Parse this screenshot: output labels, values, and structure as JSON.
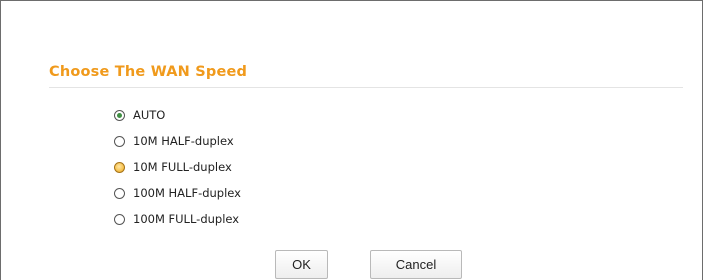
{
  "section": {
    "title": "Choose The WAN Speed"
  },
  "wan_speed": {
    "selected": "AUTO",
    "hovered": "10M FULL-duplex",
    "options": [
      {
        "label": "AUTO"
      },
      {
        "label": "10M HALF-duplex"
      },
      {
        "label": "10M FULL-duplex"
      },
      {
        "label": "100M HALF-duplex"
      },
      {
        "label": "100M FULL-duplex"
      }
    ]
  },
  "buttons": {
    "ok": "OK",
    "cancel": "Cancel"
  },
  "colors": {
    "title": "#f09a1c",
    "selected_dot": "#3f8f43",
    "hover_radio": "#f4b93a"
  }
}
